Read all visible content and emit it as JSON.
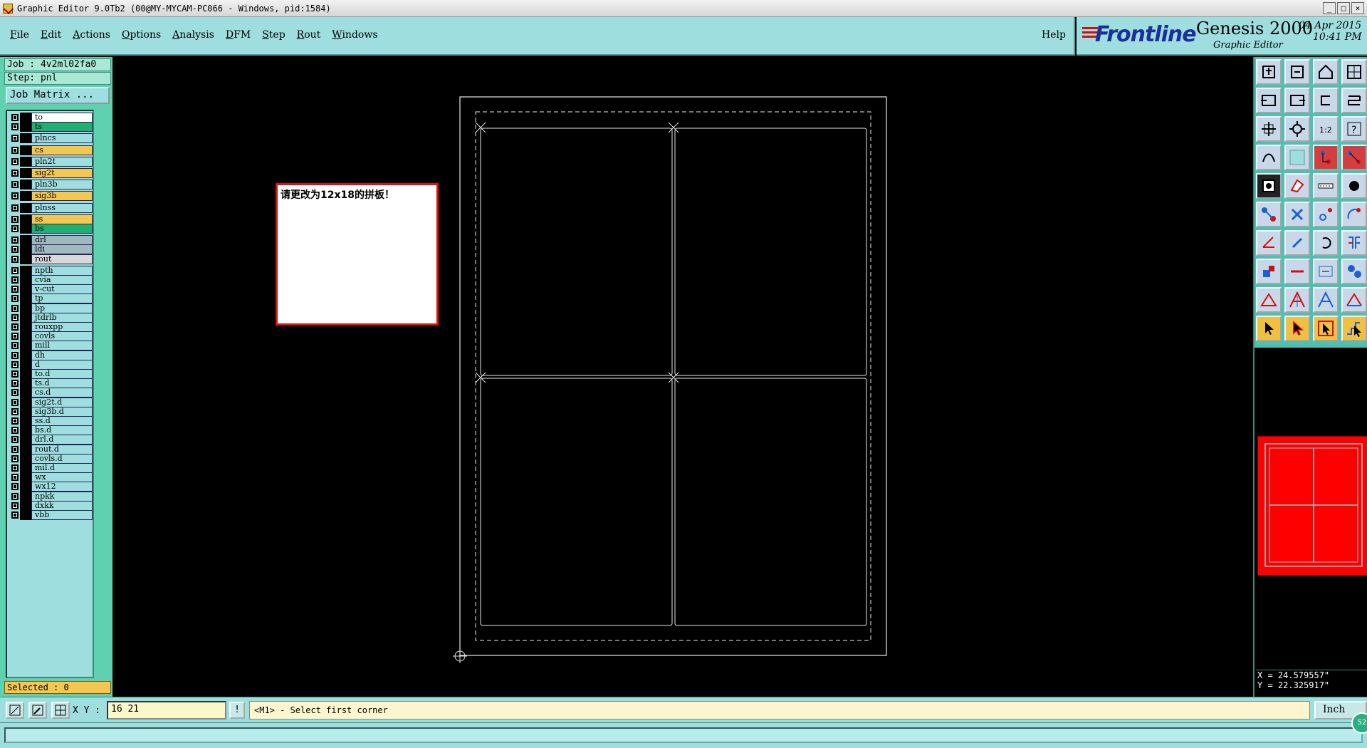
{
  "window": {
    "title": "Graphic Editor 9.0Tb2 (00@MY-MYCAM-PC066 - Windows, pid:1584)",
    "controls": [
      "_",
      "□",
      "×"
    ]
  },
  "menubar": {
    "items": [
      "File",
      "Edit",
      "Actions",
      "Options",
      "Analysis",
      "DFM",
      "Step",
      "Rout",
      "Windows"
    ],
    "help": "Help"
  },
  "brand": {
    "logo": "Frontline",
    "product": "Genesis 2000",
    "subtitle": "Graphic Editor",
    "date": "04 Apr 2015",
    "time": "10:41 PM"
  },
  "leftpanel": {
    "job": "Job : 4v2ml02fa0",
    "step": "Step: pnl",
    "job_matrix_button": "Job Matrix ...",
    "selected": "Selected : 0"
  },
  "layers": [
    {
      "name": "to",
      "color": "#ffffff",
      "gap": 0
    },
    {
      "name": "ts",
      "color": "#20b070",
      "gap": 0
    },
    {
      "name": "plncs",
      "color": "#9fdede",
      "gap": 1
    },
    {
      "name": "cs",
      "color": "#f4c850",
      "gap": 1
    },
    {
      "name": "pln2t",
      "color": "#9fdede",
      "gap": 1
    },
    {
      "name": "sig2t",
      "color": "#f4c850",
      "gap": 1
    },
    {
      "name": "pln3b",
      "color": "#9fdede",
      "gap": 1
    },
    {
      "name": "sig3b",
      "color": "#f4c850",
      "gap": 1
    },
    {
      "name": "plnss",
      "color": "#9fdede",
      "gap": 1
    },
    {
      "name": "ss",
      "color": "#f4c850",
      "gap": 1
    },
    {
      "name": "bs",
      "color": "#20b070",
      "gap": 0
    },
    {
      "name": "drl",
      "color": "#a0b8c0",
      "gap": 1
    },
    {
      "name": "ldi",
      "color": "#a0b8c0",
      "gap": 0
    },
    {
      "name": "rout",
      "color": "#d8d8d8",
      "gap": 0
    },
    {
      "name": "npth",
      "color": "#9fdede",
      "gap": 1
    },
    {
      "name": "cvia",
      "color": "#9fdede",
      "gap": 0
    },
    {
      "name": "v-cut",
      "color": "#9fdede",
      "gap": 0
    },
    {
      "name": "tp",
      "color": "#9fdede",
      "gap": 0
    },
    {
      "name": "bp",
      "color": "#9fdede",
      "gap": 0
    },
    {
      "name": "jtdrlb",
      "color": "#9fdede",
      "gap": 0
    },
    {
      "name": "rouxpp",
      "color": "#9fdede",
      "gap": 0
    },
    {
      "name": "covls",
      "color": "#9fdede",
      "gap": 0
    },
    {
      "name": "mill",
      "color": "#9fdede",
      "gap": 0
    },
    {
      "name": "dh",
      "color": "#9fdede",
      "gap": 0
    },
    {
      "name": "d",
      "color": "#9fdede",
      "gap": 0
    },
    {
      "name": "to.d",
      "color": "#9fdede",
      "gap": 0
    },
    {
      "name": "ts.d",
      "color": "#9fdede",
      "gap": 0
    },
    {
      "name": "cs.d",
      "color": "#9fdede",
      "gap": 0
    },
    {
      "name": "sig2t.d",
      "color": "#9fdede",
      "gap": 0
    },
    {
      "name": "sig3b.d",
      "color": "#9fdede",
      "gap": 0
    },
    {
      "name": "ss.d",
      "color": "#9fdede",
      "gap": 0
    },
    {
      "name": "bs.d",
      "color": "#9fdede",
      "gap": 0
    },
    {
      "name": "drl.d",
      "color": "#9fdede",
      "gap": 0
    },
    {
      "name": "rout.d",
      "color": "#9fdede",
      "gap": 0
    },
    {
      "name": "covls.d",
      "color": "#9fdede",
      "gap": 0
    },
    {
      "name": "mil.d",
      "color": "#9fdede",
      "gap": 0
    },
    {
      "name": "wx",
      "color": "#9fdede",
      "gap": 0
    },
    {
      "name": "wx12",
      "color": "#9fdede",
      "gap": 0
    },
    {
      "name": "npkk",
      "color": "#9fdede",
      "gap": 0
    },
    {
      "name": "dxkk",
      "color": "#9fdede",
      "gap": 0
    },
    {
      "name": "vbb",
      "color": "#9fdede",
      "gap": 0
    }
  ],
  "note": {
    "text": "请更改为12x18的拼板！"
  },
  "coords": {
    "x": "X = 24.579557\"",
    "y": "Y = 22.325917\""
  },
  "statusbar": {
    "xy_label": "X Y :",
    "xy_value": "16 21",
    "exclaim": "!",
    "prompt": "<M1> - Select first corner",
    "units": "Inch",
    "badge": "52"
  },
  "tools": [
    "save-icon",
    "close-icon",
    "home-icon",
    "panel-icon",
    "prev-icon",
    "next-icon",
    "undo-icon",
    "route-icon",
    "fit-icon",
    "center-icon",
    "zoom-1-2-icon",
    "help-icon",
    "snap-icon",
    "grid-icon",
    "measure-icon",
    "connect-icon",
    "feature-icon",
    "pad-icon",
    "line-icon",
    "dot-icon",
    "move-icon",
    "cross-icon",
    "point-icon",
    "arc-icon",
    "angle-icon",
    "slash-icon",
    "rotate-icon",
    "mirror-icon",
    "copy-icon",
    "minus-icon",
    "resize-icon",
    "shapes-icon",
    "triangle-icon",
    "arrow-a-icon",
    "a-icon",
    "a-arc-icon",
    "pointer-icon",
    "pointer-sel-icon",
    "pointer-box-icon",
    "pointer-step-icon"
  ]
}
